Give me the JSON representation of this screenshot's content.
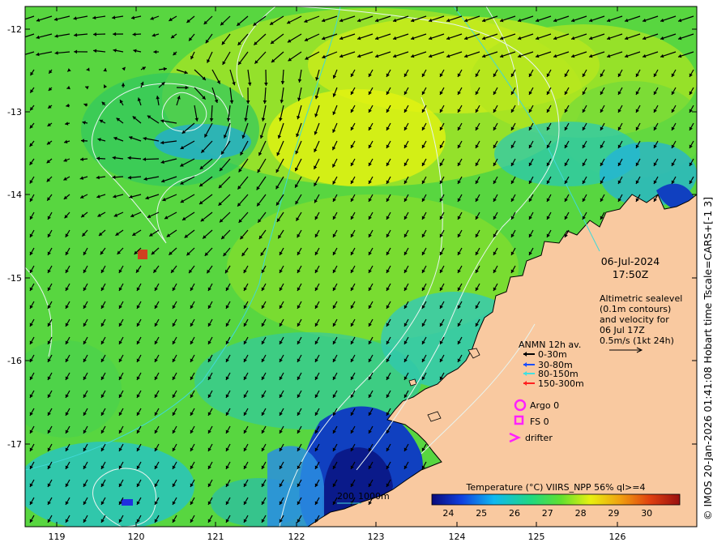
{
  "map": {
    "lon_ticks": [
      "119",
      "120",
      "121",
      "122",
      "123",
      "124",
      "125",
      "126"
    ],
    "lat_ticks": [
      "-12",
      "-13",
      "-14",
      "-15",
      "-16",
      "-17"
    ],
    "lon_range": [
      118.6,
      126.9
    ],
    "lat_range": [
      -11.95,
      -17.97
    ],
    "colors": {
      "land": "#f9c9a0",
      "coast": "#000000",
      "contour": "#e8f4f0",
      "bathy": "#40d8d8"
    }
  },
  "datetime": {
    "date": "06-Jul-2024",
    "time": "17:50Z"
  },
  "altimetry": {
    "line1": "Altimetric sealevel",
    "line2": "(0.1m contours)",
    "line3": "and velocity for",
    "line4": "06 Jul 17Z",
    "scale_label": "0.5m/s (1kt 24h)"
  },
  "anmn": {
    "title": "ANMN 12h av.",
    "items": [
      {
        "label": "0-30m",
        "color": "#000000"
      },
      {
        "label": "30-80m",
        "color": "#1a4dff"
      },
      {
        "label": "80-150m",
        "color": "#40e0e0"
      },
      {
        "label": "150-300m",
        "color": "#ff2020"
      }
    ]
  },
  "markers": {
    "argo": "Argo 0",
    "fs": "FS 0",
    "drifter": "drifter",
    "color": "#ff20ff"
  },
  "bathymetry_legend": {
    "label1": "200",
    "label2": "1000m"
  },
  "colorbar": {
    "title": "Temperature (°C) VIIRS_NPP 56% ql>=4",
    "ticks": [
      "24",
      "25",
      "26",
      "27",
      "28",
      "29",
      "30"
    ],
    "range": [
      23.5,
      31.0
    ],
    "colors": [
      "#0a0a7a",
      "#1040e0",
      "#10b8f0",
      "#20d880",
      "#60e030",
      "#e8f010",
      "#f0a010",
      "#e04010",
      "#9a1010"
    ]
  },
  "credit": "© IMOS 20-Jan-2026 01:41:08 Hobart time Tscale=CARS+[-1 3]"
}
